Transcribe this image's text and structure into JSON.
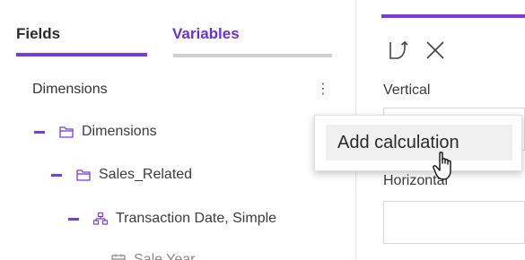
{
  "tabs": [
    {
      "label": "Fields",
      "active": true
    },
    {
      "label": "Variables",
      "active": false
    }
  ],
  "section": {
    "title": "Dimensions"
  },
  "tree": [
    {
      "label": "Dimensions",
      "icon": "folder-icon",
      "level": 0,
      "expanded": true
    },
    {
      "label": "Sales_Related",
      "icon": "folder-icon",
      "level": 1,
      "expanded": true
    },
    {
      "label": "Transaction Date, Simple",
      "icon": "hierarchy-icon",
      "level": 2,
      "expanded": true
    },
    {
      "label": "Sale Year",
      "icon": "calendar-icon",
      "level": 3,
      "expanded": false
    }
  ],
  "context_menu": {
    "items": [
      {
        "label": "Add calculation",
        "hovered": true
      }
    ]
  },
  "right_panel": {
    "tools": [
      "pivot-icon",
      "close-icon"
    ],
    "vertical_label": "Vertical",
    "horizontal_label": "Horizontal"
  },
  "colors": {
    "accent": "#7b39e0",
    "variables_tab": "#6b2fd6",
    "menu_hover": "#f0f0f0"
  }
}
